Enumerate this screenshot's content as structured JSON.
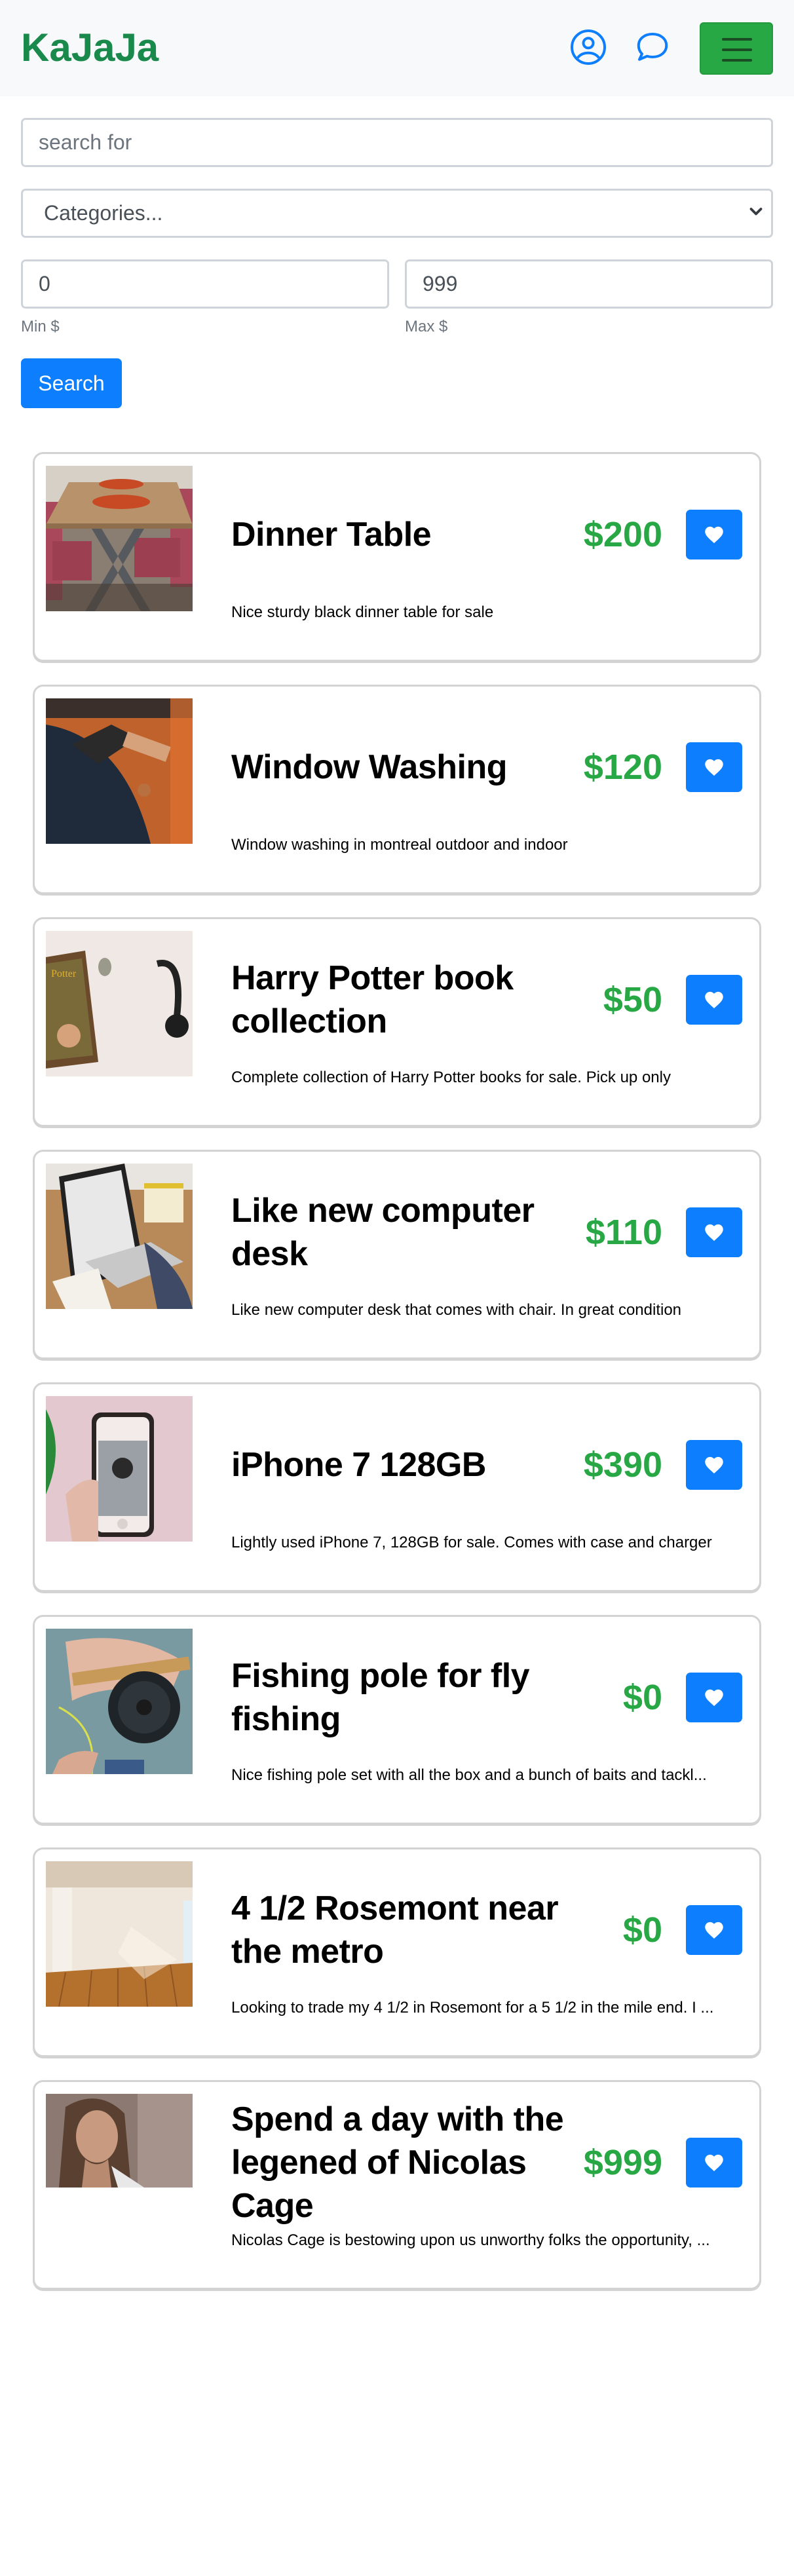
{
  "navbar": {
    "brand": "KaJaJa",
    "icons": [
      "user-circle-icon",
      "chat-bubble-icon",
      "hamburger-menu-icon"
    ]
  },
  "search": {
    "query_placeholder": "search for",
    "query_value": "",
    "category_selected": "Categories...",
    "min_price_value": "0",
    "max_price_value": "999",
    "min_label": "Min $",
    "max_label": "Max $",
    "submit_label": "Search"
  },
  "colors": {
    "brand": "#198a4c",
    "primary": "#0d7efd",
    "success": "#28a745",
    "navbar_bg": "#f8f9fa",
    "card_border": "#d3d3d3"
  },
  "listings": [
    {
      "title": "Dinner Table",
      "price": "$200",
      "description": "Nice sturdy black dinner table for sale",
      "image": "dinner-table-photo"
    },
    {
      "title": "Window Washing",
      "price": "$120",
      "description": "Window washing in montreal outdoor and indoor",
      "image": "window-washing-photo"
    },
    {
      "title": "Harry Potter book collection",
      "price": "$50",
      "description": "Complete collection of Harry Potter books for sale. Pick up only",
      "image": "harry-potter-books-photo"
    },
    {
      "title": "Like new computer desk",
      "price": "$110",
      "description": "Like new computer desk that comes with chair. In great condition",
      "image": "computer-desk-photo"
    },
    {
      "title": "iPhone 7 128GB",
      "price": "$390",
      "description": "Lightly used iPhone 7, 128GB for sale. Comes with case and charger",
      "image": "iphone-photo"
    },
    {
      "title": "Fishing pole for fly fishing",
      "price": "$0",
      "description": "Nice fishing pole set with all the box and a bunch of baits and tackl...",
      "image": "fishing-pole-photo"
    },
    {
      "title": "4 1/2 Rosemont near the metro",
      "price": "$0",
      "description": "Looking to trade my 4 1/2 in Rosemont for a 5 1/2 in the mile end. I ...",
      "image": "empty-apartment-photo"
    },
    {
      "title": "Spend a day with the legened of Nicolas Cage",
      "price": "$999",
      "description": "Nicolas Cage is bestowing upon us unworthy folks the opportunity, ...",
      "image": "nicolas-cage-photo"
    }
  ]
}
